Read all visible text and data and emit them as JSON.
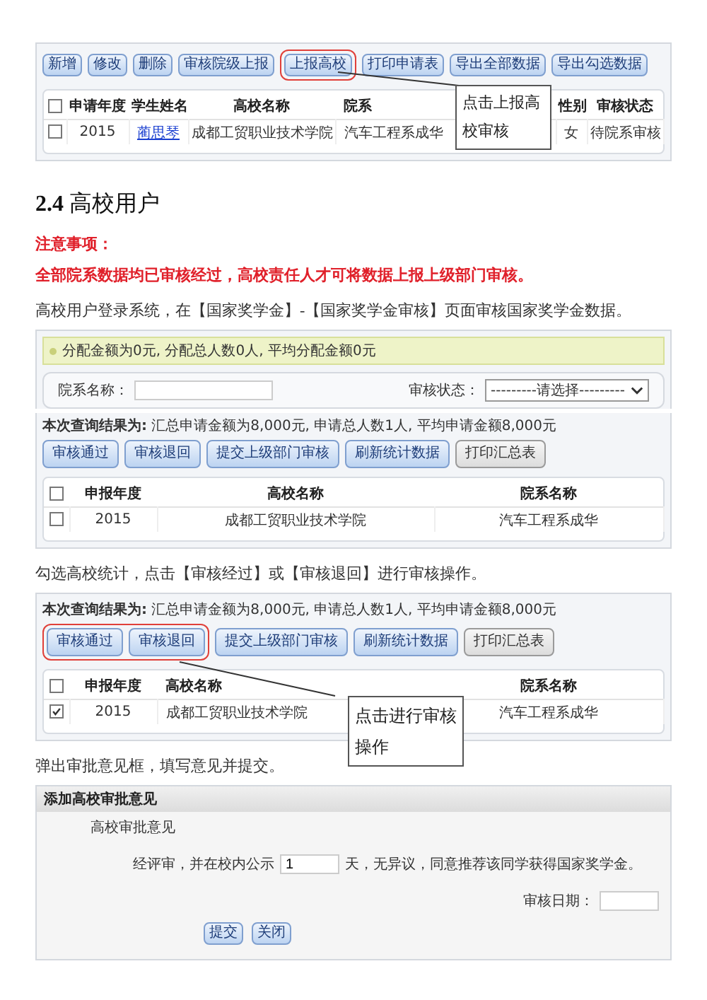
{
  "screenshot_1": {
    "buttons": [
      {
        "label": "新增",
        "highlighted": false
      },
      {
        "label": "修改",
        "highlighted": false
      },
      {
        "label": "删除",
        "highlighted": false
      },
      {
        "label": "审核院级上报",
        "highlighted": false
      },
      {
        "label": "上报高校",
        "highlighted": true
      },
      {
        "label": "打印申请表",
        "highlighted": false
      },
      {
        "label": "导出全部数据",
        "highlighted": false
      },
      {
        "label": "导出勾选数据",
        "highlighted": false
      }
    ],
    "table": {
      "header_checked": false,
      "columns": [
        "申请年度",
        "学生姓名",
        "高校名称",
        "院系",
        "性别",
        "审核状态"
      ],
      "rows": [
        {
          "checked": false,
          "cells": [
            "2015",
            "蔺思琴",
            "成都工贸职业技术学院",
            "汽车工程系成华",
            "女",
            "待院系审核"
          ]
        }
      ]
    },
    "callout": "点击上报高校审核"
  },
  "heading": "**2.4** 高校用户",
  "notice_title": "注意事项：",
  "notice_text": "全部院系数据均已审核经过，高校责任人才可将数据上报上级部门审核。",
  "intro": "高校用户登录系统，在【国家奖学金】-【国家奖学金审核】页面审核国家奖学金数据。",
  "screenshot_2": {
    "info_bar": "分配金额为0元, 分配总人数0人, 平均分配金额0元",
    "search": {
      "department_label": "院系名称：",
      "status_label": "审核状态：",
      "status_value": "---------请选择---------"
    },
    "summary": "**本次查询结果为:** 汇总申请金额为8,000元, 申请总人数1人, 平均申请金额8,000元",
    "buttons": [
      {
        "label": "审核通过",
        "highlighted": false,
        "disabled": false
      },
      {
        "label": "审核退回",
        "highlighted": false,
        "disabled": false
      },
      {
        "label": "提交上级部门审核",
        "highlighted": false,
        "disabled": false
      },
      {
        "label": "刷新统计数据",
        "highlighted": false,
        "disabled": false
      },
      {
        "label": "打印汇总表",
        "highlighted": false,
        "disabled": true
      }
    ],
    "table": {
      "header_checked": false,
      "columns": [
        "申报年度",
        "高校名称",
        "院系名称"
      ],
      "rows": [
        {
          "checked": false,
          "cells": [
            "2015",
            "成都工贸职业技术学院",
            "汽车工程系成华"
          ]
        }
      ]
    }
  },
  "step_text": "勾选高校统计，点击【审核经过】或【审核退回】进行审核操作。",
  "screenshot_3": {
    "summary": "**本次查询结果为:** 汇总申请金额为8,000元, 申请总人数1人, 平均申请金额8,000元",
    "buttons": [
      {
        "label": "审核通过",
        "highlighted": true,
        "disabled": false
      },
      {
        "label": "审核退回",
        "highlighted": true,
        "disabled": false
      },
      {
        "label": "提交上级部门审核",
        "highlighted": false,
        "disabled": false
      },
      {
        "label": "刷新统计数据",
        "highlighted": false,
        "disabled": false
      },
      {
        "label": "打印汇总表",
        "highlighted": false,
        "disabled": true
      }
    ],
    "table": {
      "header_checked": false,
      "columns": [
        "申报年度",
        "高校名称",
        "院系名称"
      ],
      "rows": [
        {
          "checked": true,
          "cells": [
            "2015",
            "成都工贸职业技术学院",
            "汽车工程系成华"
          ]
        }
      ]
    },
    "callout": "点击进行审核操作"
  },
  "dialog_text": "弹出审批意见框，填写意见并提交。",
  "screenshot_4": {
    "title": "添加高校审批意见",
    "section_label": "高校审批意见",
    "opinion_before": "经评审，并在校内公示",
    "days_value": "1",
    "opinion_after": "天，无异议，同意推荐该同学获得国家奖学金。",
    "date_label": "审核日期：",
    "buttons": [
      "提交",
      "关闭"
    ]
  }
}
